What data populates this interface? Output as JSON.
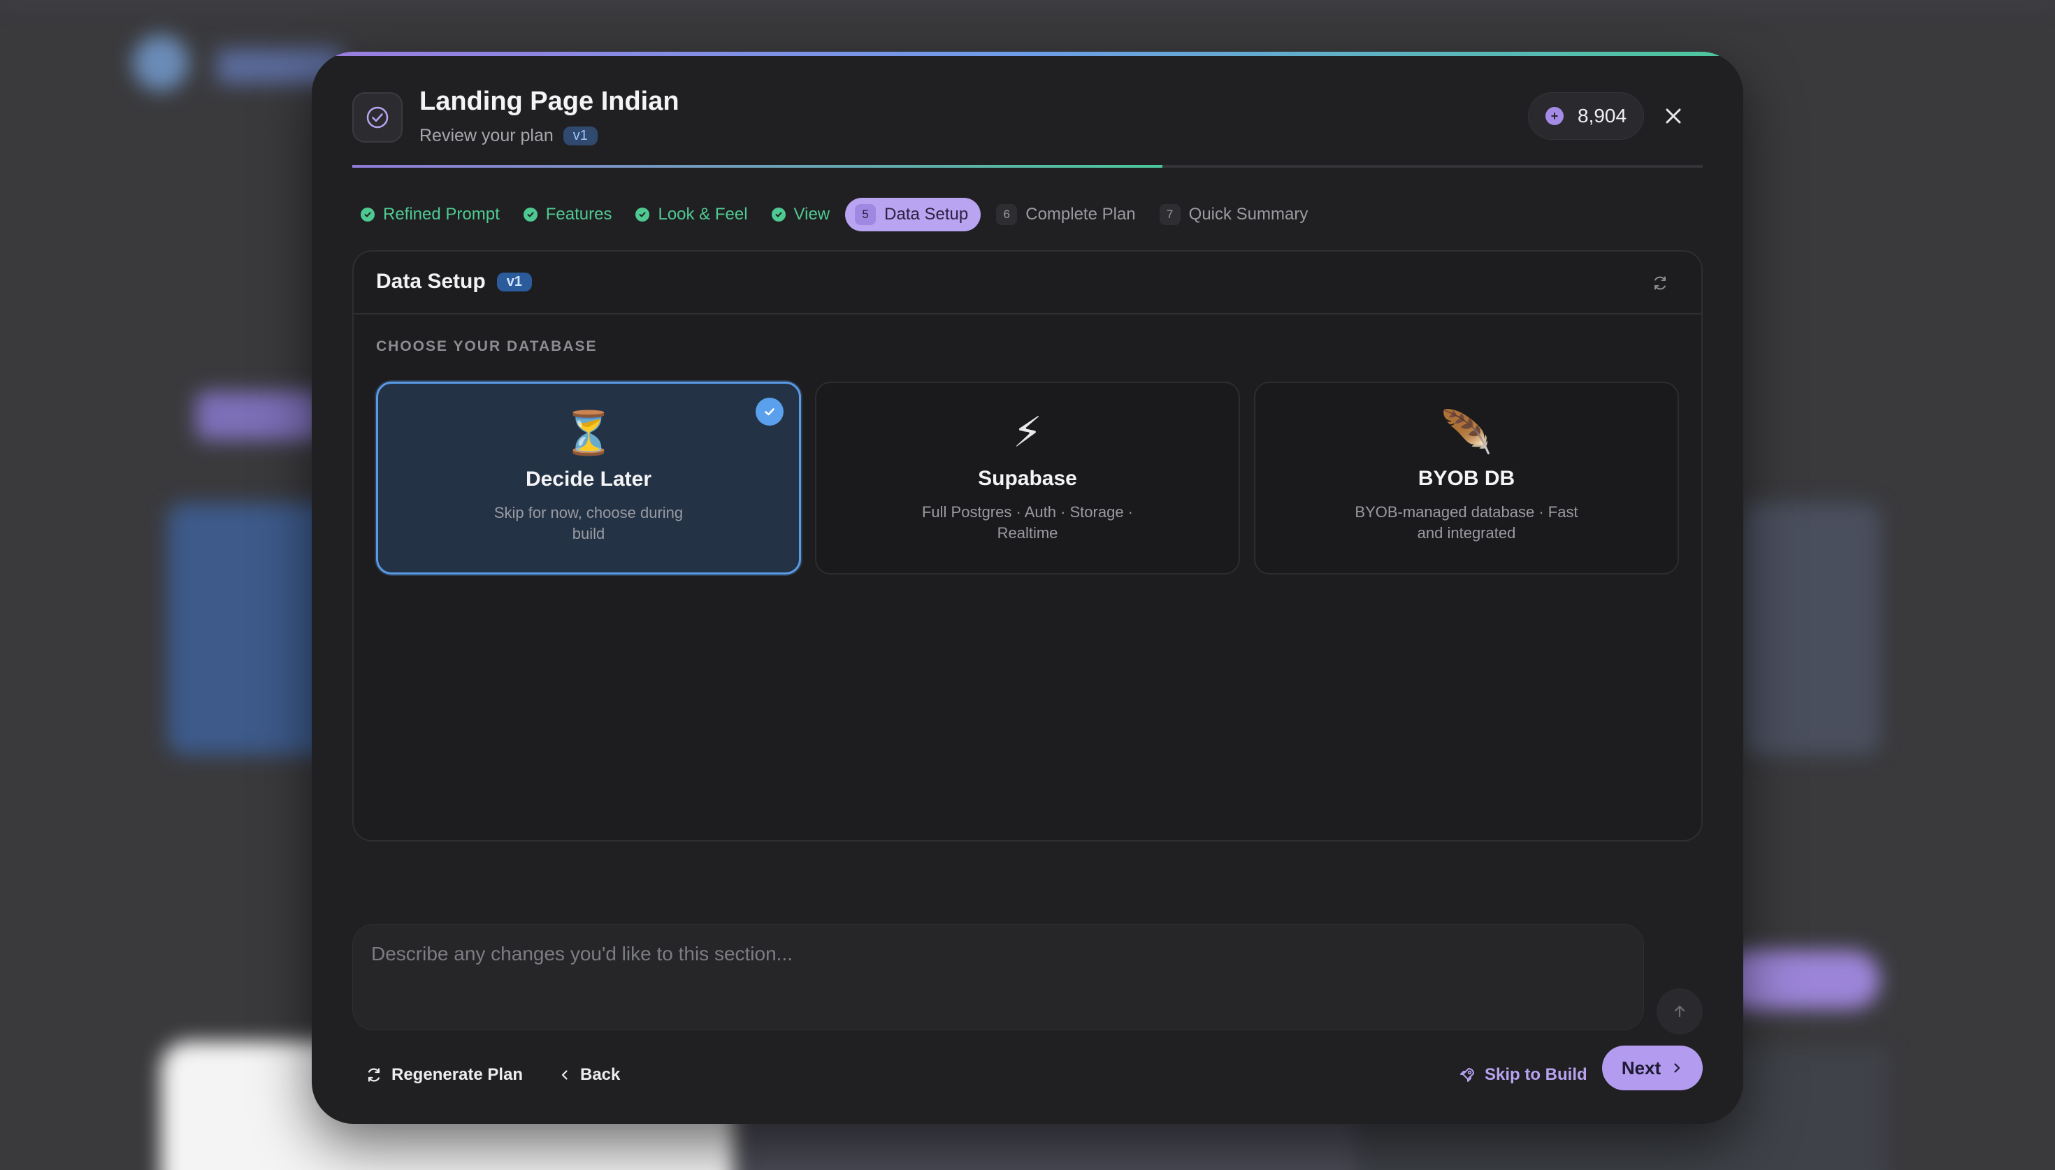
{
  "modal": {
    "title": "Landing Page Indian",
    "subtitle": "Review your plan",
    "version": "v1",
    "credits": "8,904",
    "progress": 0.6
  },
  "steps": [
    {
      "label": "Refined Prompt",
      "status": "done"
    },
    {
      "label": "Features",
      "status": "done"
    },
    {
      "label": "Look & Feel",
      "status": "done"
    },
    {
      "label": "View",
      "status": "done"
    },
    {
      "number": "5",
      "label": "Data Setup",
      "status": "active"
    },
    {
      "number": "6",
      "label": "Complete Plan",
      "status": "todo"
    },
    {
      "number": "7",
      "label": "Quick Summary",
      "status": "todo"
    }
  ],
  "panel": {
    "title": "Data Setup",
    "version": "v1",
    "section_label": "CHOOSE YOUR DATABASE",
    "options": [
      {
        "icon": "⏳",
        "icon_name": "hourglass-icon",
        "name": "Decide Later",
        "description": "Skip for now, choose during build",
        "selected": true
      },
      {
        "icon": "⚡",
        "icon_name": "lightning-icon",
        "name": "Supabase",
        "description": "Full Postgres · Auth · Storage · Realtime",
        "selected": false
      },
      {
        "icon": "🪶",
        "icon_name": "feather-icon",
        "name": "BYOB DB",
        "description": "BYOB-managed database · Fast and integrated",
        "selected": false
      }
    ]
  },
  "composer": {
    "placeholder": "Describe any changes you'd like to this section...",
    "value": ""
  },
  "footer": {
    "regenerate_label": "Regenerate Plan",
    "back_label": "Back",
    "skip_label": "Skip to Build",
    "next_label": "Next"
  },
  "colors": {
    "accent": "#b39cf0",
    "done": "#4fc992",
    "selected_border": "#5a9be6",
    "modal_bg": "#202022"
  }
}
